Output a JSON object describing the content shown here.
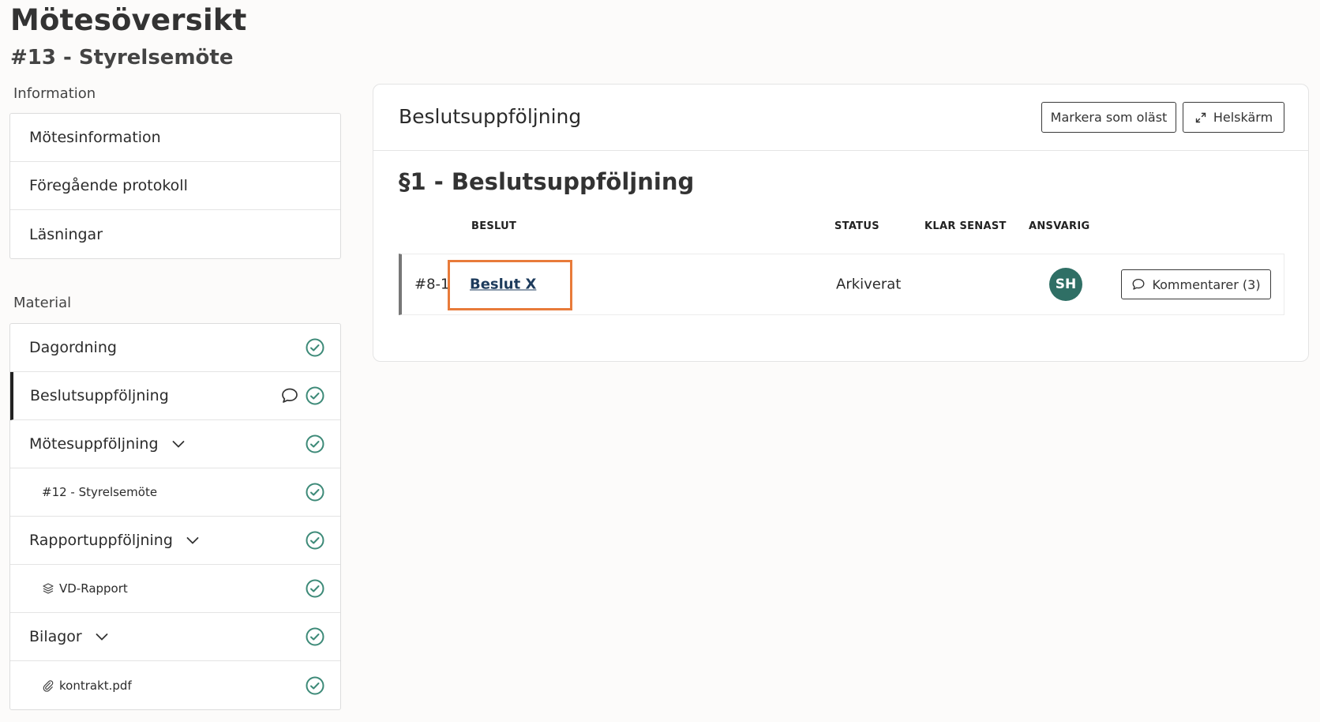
{
  "page": {
    "title": "Mötesöversikt",
    "meeting": "#13 - Styrelsemöte"
  },
  "info": {
    "label": "Information",
    "items": [
      "Mötesinformation",
      "Föregående protokoll",
      "Läsningar"
    ]
  },
  "material": {
    "label": "Material",
    "items": [
      {
        "label": "Dagordning"
      },
      {
        "label": "Beslutsuppföljning"
      },
      {
        "label": "Mötesuppföljning"
      },
      {
        "label": "#12 - Styrelsemöte"
      },
      {
        "label": "Rapportuppföljning"
      },
      {
        "label": "VD-Rapport"
      },
      {
        "label": "Bilagor"
      },
      {
        "label": "kontrakt.pdf"
      }
    ]
  },
  "main": {
    "title": "Beslutsuppföljning",
    "mark_unread": "Markera som oläst",
    "fullscreen": "Helskärm",
    "section": "§1 - Beslutsuppföljning",
    "columns": {
      "decision": "BESLUT",
      "status": "STATUS",
      "due": "KLAR SENAST",
      "owner": "ANSVARIG"
    },
    "row": {
      "id": "#8-1",
      "decision": "Beslut X",
      "status": "Arkiverat",
      "owner_initials": "SH",
      "comments": "Kommentarer (3)"
    }
  },
  "colors": {
    "check": "#3d8a78",
    "avatar": "#2f6f65",
    "highlight": "#e87b3a",
    "link": "#1d3b5c"
  }
}
